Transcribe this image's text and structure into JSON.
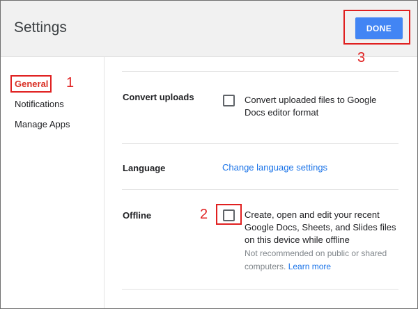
{
  "header": {
    "title": "Settings",
    "done_label": "DONE"
  },
  "sidebar": {
    "items": [
      {
        "label": "General",
        "selected": true
      },
      {
        "label": "Notifications"
      },
      {
        "label": "Manage Apps"
      }
    ]
  },
  "settings": {
    "convert_uploads": {
      "label": "Convert uploads",
      "option_line1": "Convert uploaded files to Google",
      "option_line2": "Docs editor format",
      "checked": false
    },
    "language": {
      "label": "Language",
      "link": "Change language settings"
    },
    "offline": {
      "label": "Offline",
      "line1": "Create, open and edit your recent",
      "line2": "Google Docs, Sheets, and Slides files",
      "line3": "on this device while offline",
      "note_line1": "Not recommended on public or shared",
      "note_line2": "computers.",
      "learn_more": "Learn more",
      "checked": false
    }
  },
  "annotations": {
    "one": "1",
    "two": "2",
    "three": "3"
  },
  "colors": {
    "accent": "#4285f4",
    "link": "#1a73e8",
    "annotation": "#e02020"
  }
}
